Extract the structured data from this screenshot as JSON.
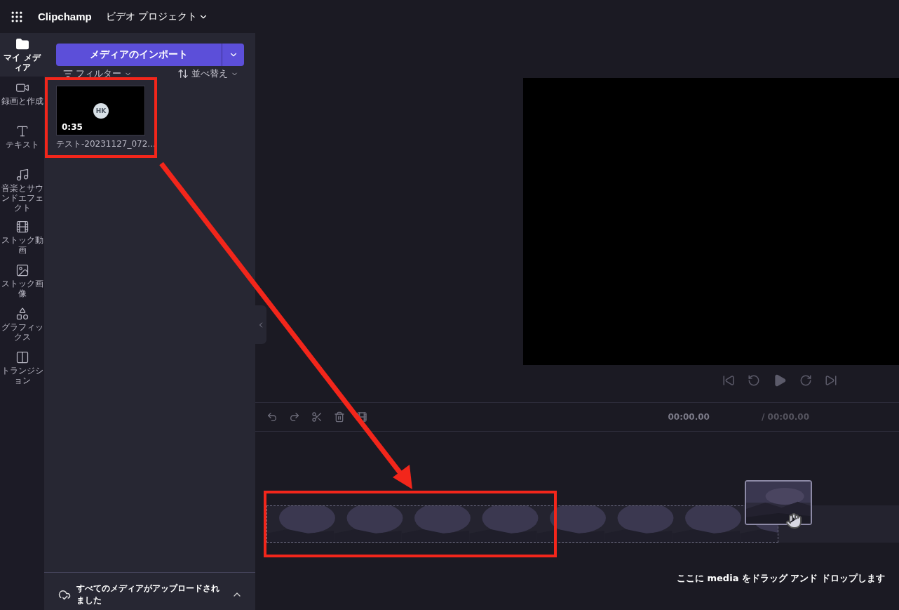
{
  "header": {
    "app_name": "Clipchamp",
    "project_title": "ビデオ プロジェクト"
  },
  "nav": [
    {
      "label": "マイ メディア",
      "selected": true
    },
    {
      "label": "録画と作成",
      "selected": false
    },
    {
      "label": "テキスト",
      "selected": false
    },
    {
      "label": "音楽とサウンドエフェクト",
      "selected": false
    },
    {
      "label": "ストック動画",
      "selected": false
    },
    {
      "label": "ストック画像",
      "selected": false
    },
    {
      "label": "グラフィックス",
      "selected": false
    },
    {
      "label": "トランジション",
      "selected": false
    }
  ],
  "media_panel": {
    "import_button": "メディアのインポート",
    "filter": "フィルター",
    "sort": "並べ替え",
    "items": [
      {
        "badge": "HK",
        "duration": "0:35",
        "name": "テスト-20231127_072..."
      }
    ],
    "upload_status": "すべてのメディアがアップロードされました"
  },
  "timeline": {
    "current_time": "00:00.00",
    "total_time": "/ 00:00.00",
    "drop_hint": "ここに media をドラッグ アンド ドロップします"
  }
}
